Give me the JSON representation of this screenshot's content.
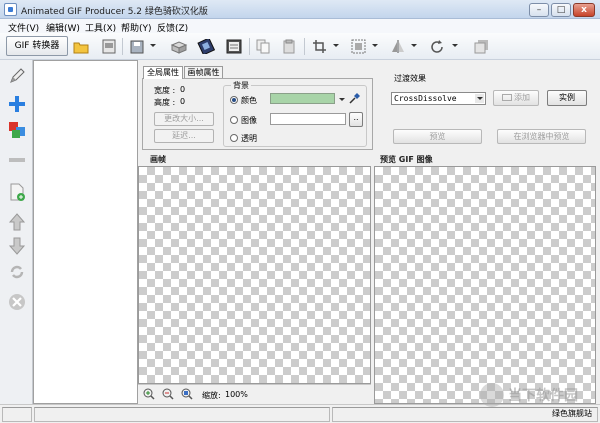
{
  "window": {
    "title": "Animated GIF Producer 5.2 绿色骑砍汉化版",
    "controls": {
      "minimize": "–",
      "maximize": "□",
      "close": "x"
    }
  },
  "menu": [
    "文件(V)",
    "编辑(W)",
    "工具(X)",
    "帮助(Y)",
    "反馈(Z)"
  ],
  "toolbar": {
    "gif_converter": "GIF 转换器",
    "icons": [
      "open-folder-icon",
      "gif-file-icon",
      "save-icon",
      "package-icon",
      "film-icon",
      "filmstrip-icon",
      "copy-icon",
      "paste-icon",
      "crop-icon",
      "resize-icon",
      "flip-icon",
      "rotate-icon",
      "layer-icon"
    ]
  },
  "left_tools": [
    "pencil-icon",
    "add-icon",
    "color-effect-icon",
    "remove-icon",
    "new-frame-icon",
    "move-up-icon",
    "move-down-icon",
    "refresh-icon",
    "delete-icon"
  ],
  "tabs": {
    "global": "全局属性",
    "frame": "画帧属性"
  },
  "global_props": {
    "width_label": "宽度 :",
    "width_value": "0",
    "height_label": "高度 :",
    "height_value": "0",
    "resize_button": "更改大小...",
    "delay_button": "延迟..."
  },
  "background": {
    "group_title": "背景",
    "color_label": "颜色",
    "image_label": "图像",
    "transparent_label": "透明",
    "selected": "color",
    "swatch_color": "#a8d4a8",
    "browse_label": ".."
  },
  "transition": {
    "title": "过渡效果",
    "selected": "CrossDissolve",
    "add_button": "添加",
    "example_button": "实例",
    "preview_button": "预览",
    "browser_preview_button": "在浏览器中预览"
  },
  "panes": {
    "frame": "画帧",
    "preview": "预览  GIF 图像"
  },
  "zoom": {
    "label": "缩放:",
    "value": "100%"
  },
  "watermark": {
    "text": "当下软件园",
    "brand": "绿色旗舰站"
  }
}
